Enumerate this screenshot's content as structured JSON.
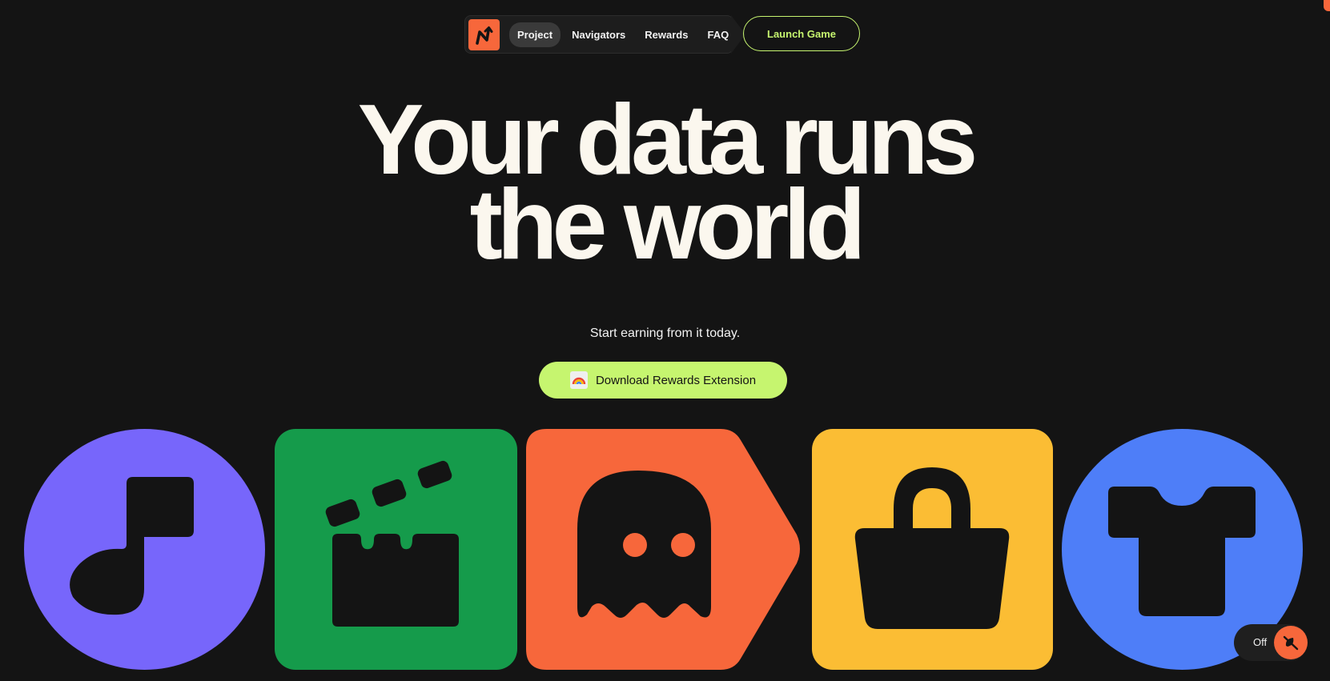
{
  "nav": {
    "logo_alt": "N",
    "links": [
      {
        "label": "Project",
        "active": true
      },
      {
        "label": "Navigators",
        "active": false
      },
      {
        "label": "Rewards",
        "active": false
      },
      {
        "label": "FAQ",
        "active": false
      }
    ],
    "cta_label": "Launch Game"
  },
  "hero": {
    "title_line1": "Your data runs",
    "title_line2": "the world",
    "subtitle": "Start earning from it today.",
    "download_label": "Download Rewards Extension"
  },
  "categories": [
    {
      "icon": "music-note-icon",
      "color": "#7766fb"
    },
    {
      "icon": "clapperboard-icon",
      "color": "#159b4b"
    },
    {
      "icon": "ghost-icon",
      "color": "#f7673b"
    },
    {
      "icon": "shopping-bag-icon",
      "color": "#fbbd34"
    },
    {
      "icon": "t-shirt-icon",
      "color": "#4e7ef8"
    }
  ],
  "toggle": {
    "label": "Off",
    "icon": "crossed-leaf-icon"
  },
  "colors": {
    "background": "#141414",
    "accent": "#c6f56f",
    "brand": "#f7673b",
    "text": "#fbf7ee"
  }
}
